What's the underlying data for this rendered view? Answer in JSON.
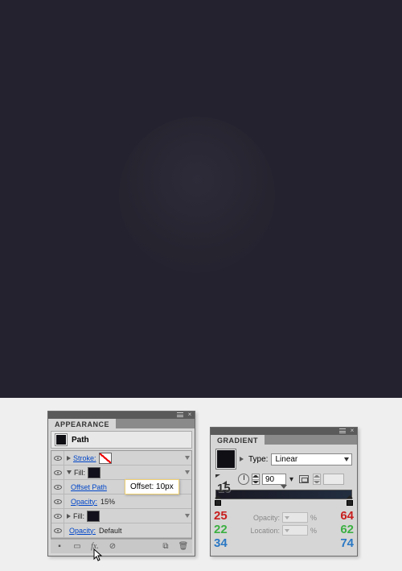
{
  "canvas": {
    "bg": "#24222f"
  },
  "appearance": {
    "tab_label": "APPEARANCE",
    "title": "Path",
    "stroke_label": "Stroke:",
    "fill_label": "Fill:",
    "offset_path_label": "Offset Path",
    "offset_tooltip": "Offset: 10px",
    "opacity_label": "Opacity:",
    "opacity_value_15": "15%",
    "opacity_label2": "Opacity:",
    "opacity_default": "Default",
    "fx_label": "fx."
  },
  "fifteen": "15",
  "gradient": {
    "tab_label": "GRADIENT",
    "type_label": "Type:",
    "type_value": "Linear",
    "angle_value": "90",
    "opacity_label": "Opacity:",
    "location_label": "Location:",
    "percent": "%",
    "stops_left": {
      "r": "25",
      "g": "22",
      "b": "34"
    },
    "stops_right": {
      "r": "64",
      "g": "62",
      "b": "74"
    }
  }
}
